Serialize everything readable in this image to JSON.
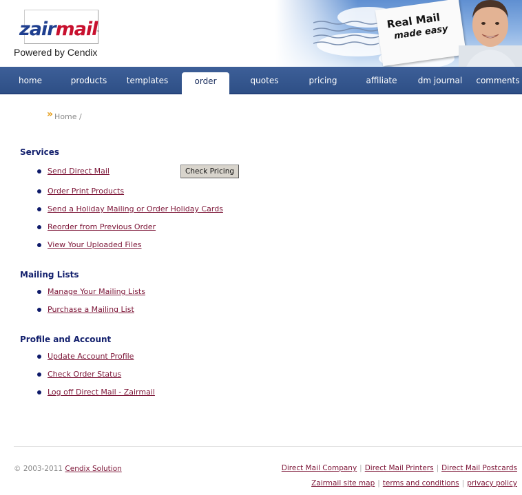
{
  "logo": {
    "brand_part1": "zair",
    "brand_part2": "mail",
    "trademark": "™",
    "tagline": "Powered by Cendix"
  },
  "banner": {
    "card_line1": "Real Mail",
    "card_line2": "made easy"
  },
  "nav": {
    "items": [
      {
        "label": "home",
        "active": false
      },
      {
        "label": "products",
        "active": false
      },
      {
        "label": "templates",
        "active": false
      },
      {
        "label": "order",
        "active": true
      },
      {
        "label": "quotes",
        "active": false
      },
      {
        "label": "pricing",
        "active": false
      },
      {
        "label": "affiliate",
        "active": false
      },
      {
        "label": "dm journal",
        "active": false
      },
      {
        "label": "comments",
        "active": false
      }
    ]
  },
  "breadcrumb": {
    "chevron": "»",
    "home": "Home",
    "separator": "/"
  },
  "sections": {
    "services": {
      "title": "Services",
      "links": [
        "Send Direct Mail",
        "Order Print Products",
        "Send a Holiday Mailing or Order Holiday Cards",
        "Reorder from Previous Order",
        "View Your Uploaded Files"
      ],
      "check_pricing_label": "Check Pricing"
    },
    "mailing_lists": {
      "title": "Mailing Lists",
      "links": [
        "Manage Your Mailing Lists",
        "Purchase a Mailing List"
      ]
    },
    "profile": {
      "title": "Profile and Account",
      "links": [
        "Update Account Profile",
        "Check Order Status",
        "Log off Direct Mail - Zairmail"
      ]
    }
  },
  "footer": {
    "copyright": "© 2003-2011",
    "company_link": "Cendix Solution",
    "row1": [
      "Direct Mail Company",
      "Direct Mail Printers",
      "Direct Mail Postcards"
    ],
    "row2": [
      "Zairmail site map",
      "terms and conditions",
      "privacy policy"
    ],
    "separator": "|"
  },
  "colors": {
    "nav_bg": "#2e4f86",
    "link": "#7c1436",
    "section_title": "#14216e",
    "bullet": "#0e1a6a",
    "chevron": "#e59a12"
  }
}
